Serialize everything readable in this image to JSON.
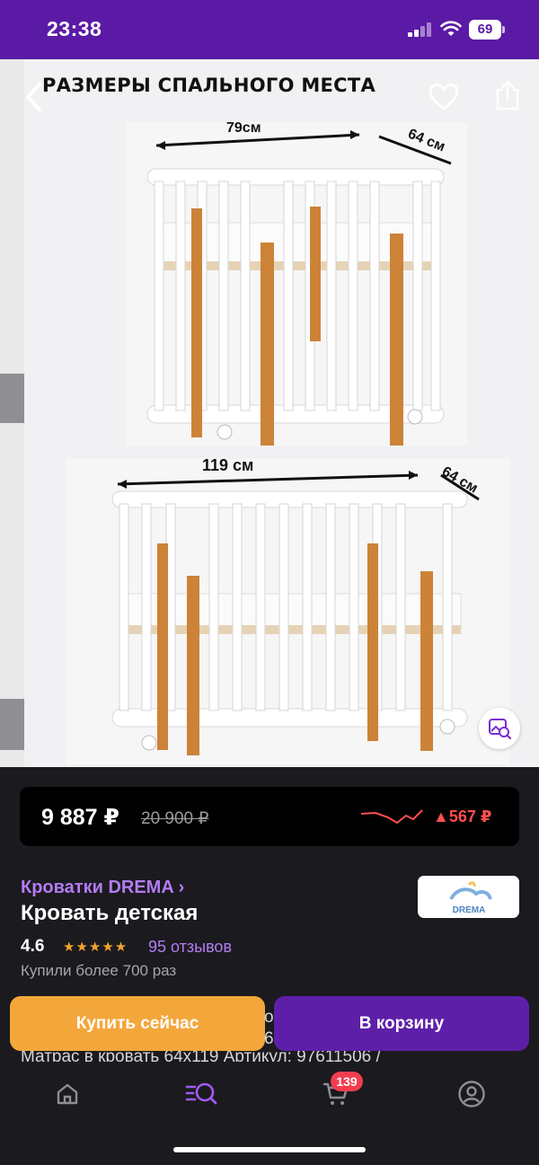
{
  "status_bar": {
    "time": "23:38",
    "battery": "69"
  },
  "gallery": {
    "heading": "РАЗМЕРЫ СПАЛЬНОГО МЕСТА",
    "top_width": "79см",
    "top_depth": "64 см",
    "bottom_width": "119 см",
    "bottom_depth": "64 см"
  },
  "price": {
    "current": "9 887 ₽",
    "old": "20 900 ₽",
    "delta": "▲567 ₽"
  },
  "product": {
    "brand_link": "Кроватки DREMA ›",
    "title": "Кровать детская",
    "brand_logo_text": "DREMA",
    "rating": "4.6",
    "stars": "★★★★★",
    "reviews": "95 отзывов",
    "bought": "Купили более 700 раз",
    "desc_right_1": "о",
    "desc_right_2": "64",
    "desc_bottom": "Матрас в кровать 64х119 Артикул: 97611506 /"
  },
  "actions": {
    "buy_now": "Купить сейчас",
    "add_to_cart": "В корзину"
  },
  "tabbar": {
    "cart_count": "139"
  },
  "colors": {
    "brand_purple": "#5b1aa6",
    "accent_link": "#b37cf2",
    "buy_orange": "#f3a73b",
    "price_up_red": "#ff4f4f"
  }
}
